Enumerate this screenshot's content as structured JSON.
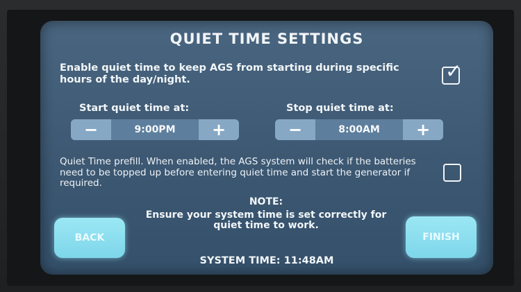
{
  "title": "QUIET TIME SETTINGS",
  "enable": {
    "text": "Enable quiet time to keep AGS from starting during specific hours of the day/night.",
    "checked": true
  },
  "start": {
    "label": "Start quiet time at:",
    "minus": "−",
    "value": "9:00PM",
    "plus": "+"
  },
  "stop": {
    "label": "Stop quiet time at:",
    "minus": "−",
    "value": "8:00AM",
    "plus": "+"
  },
  "prefill": {
    "text": "Quiet Time prefill. When enabled, the AGS system will check if the batteries need to be topped up before entering quiet time and start the generator if required.",
    "checked": false
  },
  "note": {
    "heading": "NOTE:",
    "body": "Ensure your system time is set correctly for quiet time to work."
  },
  "buttons": {
    "back": "BACK",
    "finish": "FINISH"
  },
  "system_time": "SYSTEM TIME: 11:48AM",
  "colors": {
    "panel": "#3d5872",
    "stepper_button": "#86a8c4",
    "action_button": "#8ddff0"
  }
}
